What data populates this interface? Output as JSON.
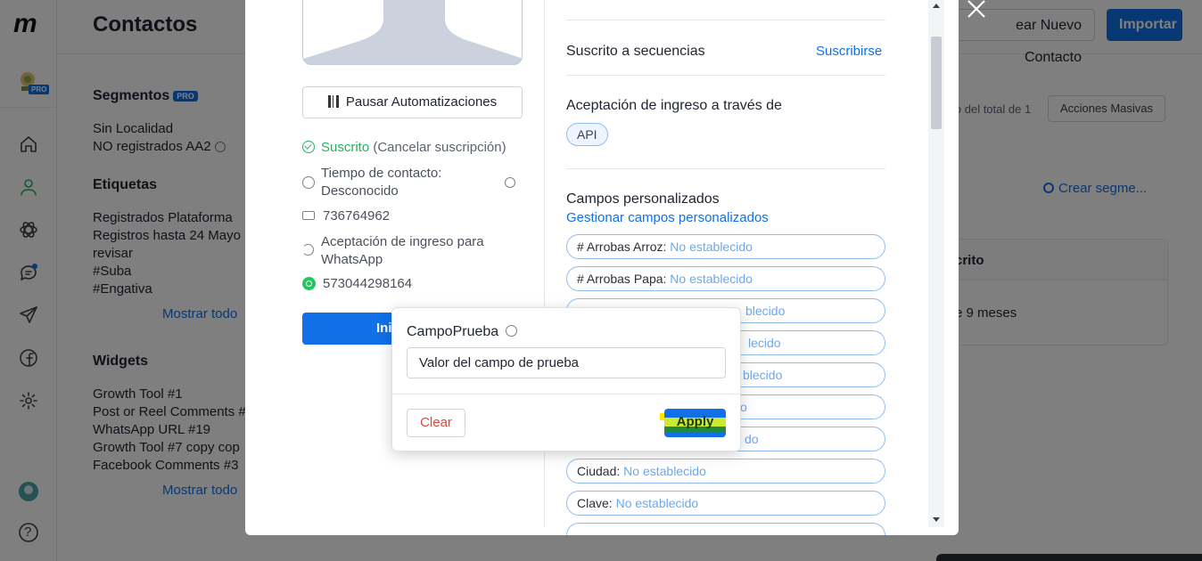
{
  "rail": {
    "logo": "m",
    "avatar_badge": "PRO",
    "icons": [
      "home-icon",
      "contacts-icon",
      "automation-icon",
      "chat-icon",
      "send-icon",
      "facebook-icon",
      "settings-icon"
    ],
    "help": "?"
  },
  "header": {
    "title": "Contactos",
    "create_contact_btn": "ear Nuevo Contacto",
    "import_btn": "Importar"
  },
  "left_panel": {
    "segments_title": "Segmentos",
    "segments_badge": "PRO",
    "segments": [
      "Sin Localidad",
      "NO registrados AA2"
    ],
    "tags_title": "Etiquetas",
    "tags": [
      "Registrados Plataforma",
      "Registros hasta 24 Mayo",
      "revisar",
      "#Suba",
      "#Engativa"
    ],
    "tags_show_all": "Mostrar todo",
    "widgets_title": "Widgets",
    "widgets": [
      "Growth Tool #1",
      "Post or Reel Comments #",
      "WhatsApp URL #19",
      "Growth Tool #7 copy cop",
      "Facebook Comments #3"
    ],
    "widgets_show_all": "Mostrar todo"
  },
  "right_bg": {
    "count_text": "lo del total de 1",
    "bulk_actions": "Acciones Masivas",
    "create_segment": "Crear segme...",
    "col_header": "crito",
    "cell": "e 9 meses"
  },
  "modal": {
    "pause_btn": "Pausar Automatizaciones",
    "subscribed": "Suscrito",
    "unsubscribe": "(Cancelar suscripción)",
    "contact_time_label": "Tiempo de contacto:",
    "contact_time_value": "Desconocido",
    "id_value": "736764962",
    "whatsapp_optin_line1": "Aceptación de ingreso para",
    "whatsapp_optin_line2": "WhatsApp",
    "phone": "573044298164",
    "start_btn": "Ini",
    "sequences_label": "Suscrito a secuencias",
    "sequences_link": "Suscribirse",
    "optin_title": "Aceptación de ingreso a través de",
    "optin_chip": "API",
    "custom_fields_title": "Campos personalizados",
    "custom_fields_link": "Gestionar campos personalizados",
    "not_set": "No establecido",
    "fields": [
      {
        "name": "# Arrobas Arroz:",
        "value": "No establecido"
      },
      {
        "name": "# Arrobas Papa:",
        "value": "No establecido"
      },
      {
        "name": "",
        "value": "blecido"
      },
      {
        "name": "",
        "value": "lecido"
      },
      {
        "name": "",
        "value": "blecido"
      },
      {
        "name": "",
        "value": "o"
      },
      {
        "name": "",
        "value": "do"
      },
      {
        "name": "Ciudad:",
        "value": "No establecido"
      },
      {
        "name": "Clave:",
        "value": "No establecido"
      }
    ]
  },
  "popup": {
    "label": "CampoPrueba",
    "input_value": "Valor del campo de prueba",
    "clear_btn": "Clear",
    "apply_btn": "Apply"
  },
  "colors": {
    "accent": "#1170e8",
    "success": "#22b35e",
    "danger": "#e0453a"
  }
}
